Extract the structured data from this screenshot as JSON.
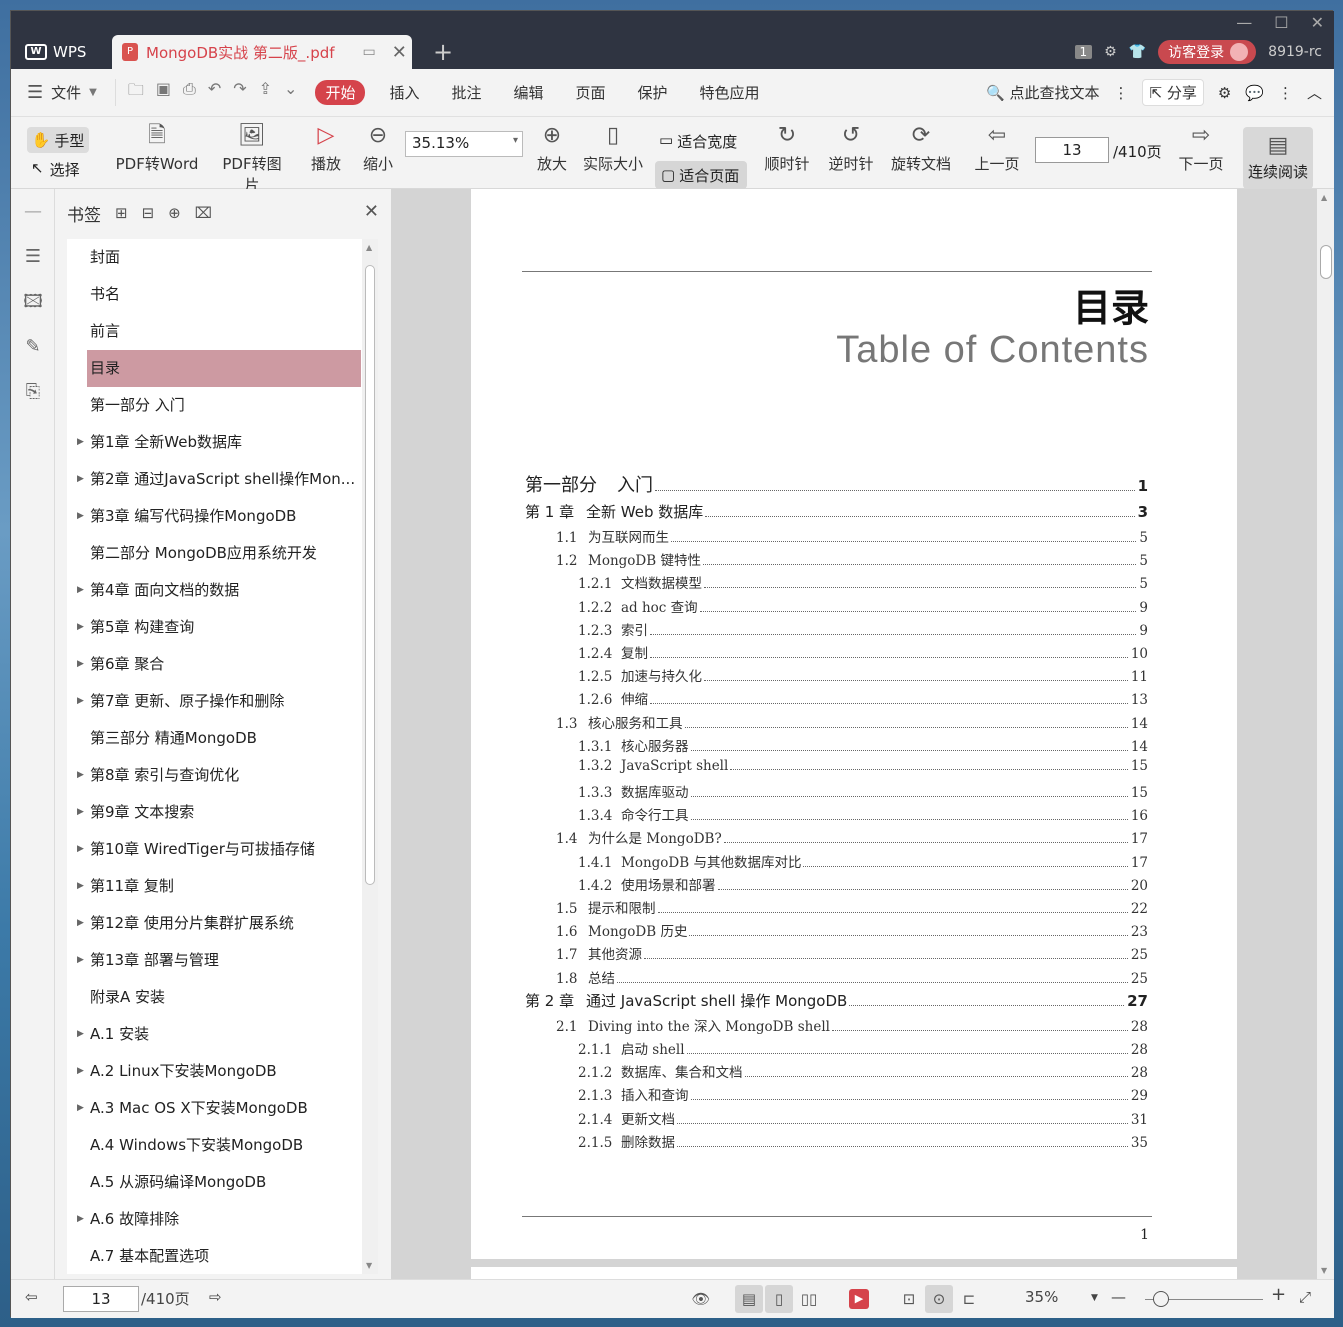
{
  "titlebar": {
    "app_name": "WPS",
    "doc_tab": "MongoDB实战 第二版_.pdf",
    "page_badge": "1",
    "login": "访客登录",
    "version": "8919-rc"
  },
  "menubar": {
    "file": "文件",
    "start": "开始",
    "items": [
      "插入",
      "批注",
      "编辑",
      "页面",
      "保护",
      "特色应用"
    ],
    "search": "点此查找文本",
    "share": "分享"
  },
  "toolbar": {
    "hand": "手型",
    "select": "选择",
    "pdf2word": "PDF转Word",
    "pdf2img": "PDF转图片",
    "play": "播放",
    "zoom_out": "缩小",
    "zoom_value": "35.13%",
    "zoom_in": "放大",
    "actual_size": "实际大小",
    "fit_width": "适合宽度",
    "fit_page": "适合页面",
    "rotate_cw": "顺时针",
    "rotate_ccw": "逆时针",
    "rotate_doc": "旋转文档",
    "prev_page": "上一页",
    "page_input": "13",
    "page_total": "/410页",
    "next_page": "下一页",
    "continuous": "连续阅读"
  },
  "bookmarks": {
    "title": "书签",
    "items": [
      {
        "label": "封面",
        "arrow": false
      },
      {
        "label": "书名",
        "arrow": false
      },
      {
        "label": "前言",
        "arrow": false
      },
      {
        "label": "目录",
        "arrow": false,
        "active": true
      },
      {
        "label": "第一部分 入门",
        "arrow": false
      },
      {
        "label": "第1章 全新Web数据库",
        "arrow": true
      },
      {
        "label": "第2章 通过JavaScript shell操作Mon...",
        "arrow": true
      },
      {
        "label": "第3章 编写代码操作MongoDB",
        "arrow": true
      },
      {
        "label": "第二部分 MongoDB应用系统开发",
        "arrow": false
      },
      {
        "label": "第4章 面向文档的数据",
        "arrow": true
      },
      {
        "label": "第5章 构建查询",
        "arrow": true
      },
      {
        "label": "第6章 聚合",
        "arrow": true
      },
      {
        "label": "第7章 更新、原子操作和删除",
        "arrow": true
      },
      {
        "label": "第三部分 精通MongoDB",
        "arrow": false
      },
      {
        "label": "第8章 索引与查询优化",
        "arrow": true
      },
      {
        "label": "第9章 文本搜索",
        "arrow": true
      },
      {
        "label": "第10章 WiredTiger与可拔插存储",
        "arrow": true
      },
      {
        "label": "第11章 复制",
        "arrow": true
      },
      {
        "label": "第12章 使用分片集群扩展系统",
        "arrow": true
      },
      {
        "label": "第13章 部署与管理",
        "arrow": true
      },
      {
        "label": "附录A 安装",
        "arrow": false
      },
      {
        "label": "A.1 安装",
        "arrow": true
      },
      {
        "label": "A.2 Linux下安装MongoDB",
        "arrow": true
      },
      {
        "label": "A.3 Mac OS X下安装MongoDB",
        "arrow": true
      },
      {
        "label": "A.4 Windows下安装MongoDB",
        "arrow": false
      },
      {
        "label": "A.5 从源码编译MongoDB",
        "arrow": false
      },
      {
        "label": "A.6 故障排除",
        "arrow": true
      },
      {
        "label": "A.7 基本配置选项",
        "arrow": false
      }
    ]
  },
  "page": {
    "title": "目录",
    "subtitle": "Table of Contents",
    "footer_page": "1",
    "toc": [
      {
        "level": "part",
        "num": "第一部分",
        "text": "入门",
        "page": "1"
      },
      {
        "level": "ch",
        "num": "第 1 章",
        "text": "全新 Web 数据库",
        "page": "3"
      },
      {
        "level": "l2",
        "num": "1.1",
        "text": "为互联网而生",
        "page": "5"
      },
      {
        "level": "l2",
        "num": "1.2",
        "text": "MongoDB 键特性",
        "page": "5"
      },
      {
        "level": "l3",
        "num": "1.2.1",
        "text": "文档数据模型",
        "page": "5"
      },
      {
        "level": "l3",
        "num": "1.2.2",
        "text": "ad hoc 查询",
        "page": "9"
      },
      {
        "level": "l3",
        "num": "1.2.3",
        "text": "索引",
        "page": "9"
      },
      {
        "level": "l3",
        "num": "1.2.4",
        "text": "复制",
        "page": "10"
      },
      {
        "level": "l3",
        "num": "1.2.5",
        "text": "加速与持久化",
        "page": "11"
      },
      {
        "level": "l3",
        "num": "1.2.6",
        "text": "伸缩",
        "page": "13"
      },
      {
        "level": "l2",
        "num": "1.3",
        "text": "核心服务和工具",
        "page": "14"
      },
      {
        "level": "l3",
        "num": "1.3.1",
        "text": "核心服务器",
        "page": "14"
      },
      {
        "level": "l3",
        "num": "1.3.2",
        "text": "JavaScript shell",
        "page": "15"
      },
      {
        "level": "l3",
        "num": "1.3.3",
        "text": "数据库驱动",
        "page": "15"
      },
      {
        "level": "l3",
        "num": "1.3.4",
        "text": "命令行工具",
        "page": "16"
      },
      {
        "level": "l2",
        "num": "1.4",
        "text": "为什么是 MongoDB?",
        "page": "17"
      },
      {
        "level": "l3",
        "num": "1.4.1",
        "text": "MongoDB 与其他数据库对比",
        "page": "17"
      },
      {
        "level": "l3",
        "num": "1.4.2",
        "text": "使用场景和部署",
        "page": "20"
      },
      {
        "level": "l2",
        "num": "1.5",
        "text": "提示和限制",
        "page": "22"
      },
      {
        "level": "l2",
        "num": "1.6",
        "text": "MongoDB 历史",
        "page": "23"
      },
      {
        "level": "l2",
        "num": "1.7",
        "text": "其他资源",
        "page": "25"
      },
      {
        "level": "l2",
        "num": "1.8",
        "text": "总结",
        "page": "25"
      },
      {
        "level": "ch",
        "num": "第 2 章",
        "text": "通过 JavaScript shell 操作 MongoDB",
        "page": "27"
      },
      {
        "level": "l2",
        "num": "2.1",
        "text": "Diving into the 深入 MongoDB shell",
        "page": "28"
      },
      {
        "level": "l3",
        "num": "2.1.1",
        "text": "启动 shell",
        "page": "28"
      },
      {
        "level": "l3",
        "num": "2.1.2",
        "text": "数据库、集合和文档",
        "page": "28"
      },
      {
        "level": "l3",
        "num": "2.1.3",
        "text": "插入和查询",
        "page": "29"
      },
      {
        "level": "l3",
        "num": "2.1.4",
        "text": "更新文档",
        "page": "31"
      },
      {
        "level": "l3",
        "num": "2.1.5",
        "text": "删除数据",
        "page": "35"
      }
    ]
  },
  "status": {
    "page_input": "13",
    "page_total": "/410页",
    "zoom": "35%"
  }
}
